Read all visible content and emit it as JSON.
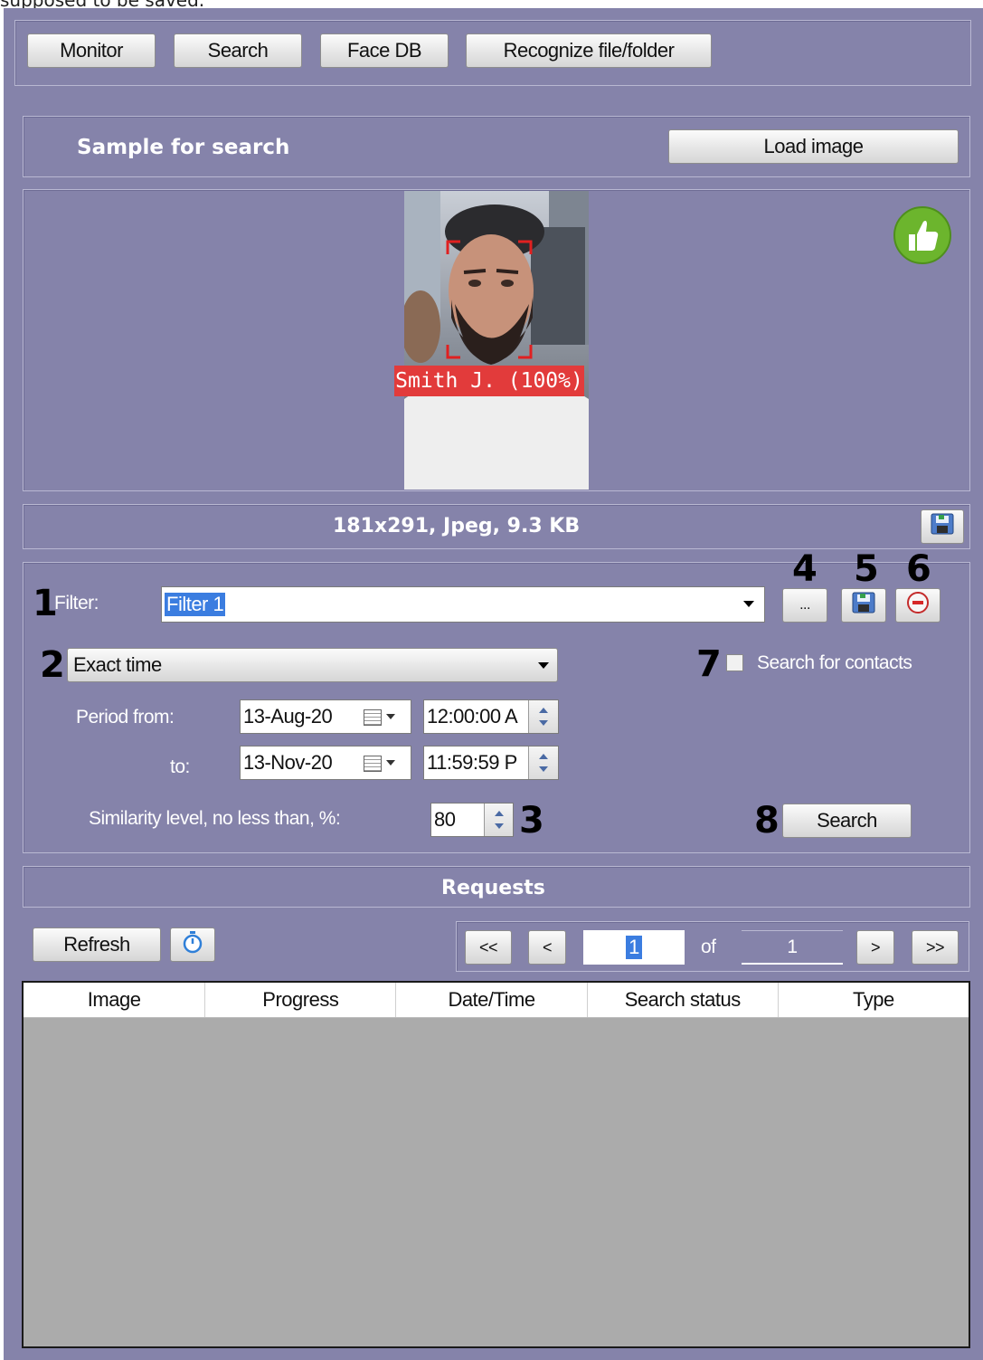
{
  "caption_top": "supposed to be saved.",
  "top_buttons": [
    "Monitor",
    "Search",
    "Face DB",
    "Recognize file/folder"
  ],
  "sample": {
    "title": "Sample for search",
    "load_button": "Load image",
    "face_label": "Smith J. (100%)",
    "image_info": "181x291, Jpeg, 9.3 KB"
  },
  "filter": {
    "label": "Filter:",
    "value": "Filter 1",
    "more_button": "...",
    "time_mode": "Exact time",
    "search_contacts_label": "Search for contacts",
    "period_from_label": "Period from:",
    "to_label": "to:",
    "date_from": "13-Aug-20",
    "time_from": "12:00:00 A",
    "date_to": "13-Nov-20",
    "time_to": "11:59:59 P",
    "similarity_label": "Similarity level, no less than, %:",
    "similarity_value": "80",
    "search_button": "Search"
  },
  "callouts": [
    "1",
    "2",
    "3",
    "4",
    "5",
    "6",
    "7",
    "8"
  ],
  "requests": {
    "title": "Requests",
    "refresh_button": "Refresh",
    "first_button": "<<",
    "prev_button": "<",
    "page": "1",
    "of_label": "of",
    "total_pages": "1",
    "next_button": ">",
    "last_button": ">>",
    "columns": [
      "Image",
      "Progress",
      "Date/Time",
      "Search status",
      "Type"
    ]
  },
  "colors": {
    "panel_bg": "#8583aa",
    "face_label_bg": "#e23b3b",
    "thumbs_up": "#6cb52d"
  }
}
